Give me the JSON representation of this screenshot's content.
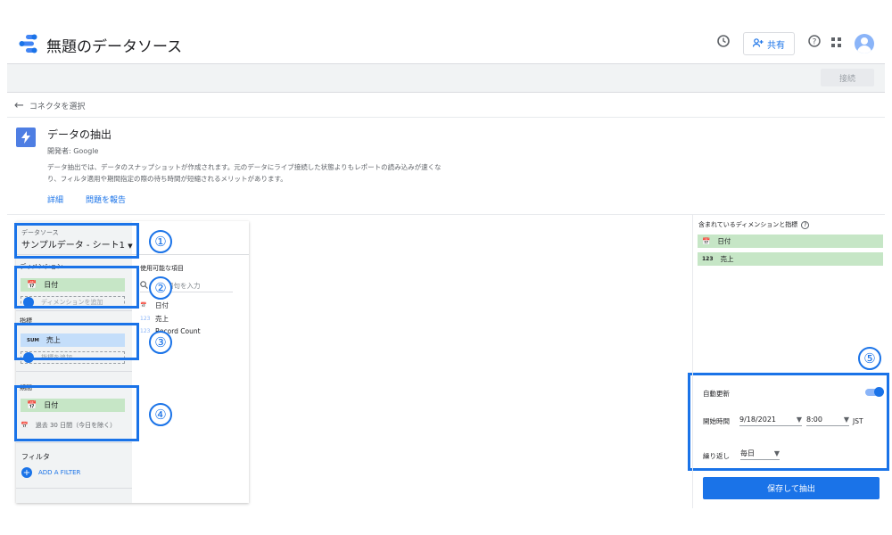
{
  "header": {
    "title": "無題のデータソース",
    "share_label": "共有",
    "icons": [
      "history-icon",
      "add-person-icon",
      "help-icon",
      "apps-grid-icon",
      "account-icon"
    ]
  },
  "toolbar": {
    "connect_label": "接続"
  },
  "back": {
    "label": "コネクタを選択"
  },
  "connector": {
    "title": "データの抽出",
    "developer": "開発者: Google",
    "description_line1": "データ抽出では、データのスナップショットが作成されます。元のデータにライブ接続した状態よりもレポートの読み込みが速くな",
    "description_line2": "り、フィルタ適用や期間指定の際の待ち時間が短縮されるメリットがあります。",
    "link_details": "詳細",
    "link_report": "問題を報告"
  },
  "config": {
    "datasource_label": "データソース",
    "datasource_value": "サンプルデータ - シート1",
    "dimension_label": "ディメンション",
    "dimension_chip": "日付",
    "dimension_add": "ディメンションを追加",
    "metric_label": "指標",
    "metric_chip": "売上",
    "metric_add": "指標を追加",
    "period_label": "期間",
    "period_chip": "日付",
    "period_range": "過去 30 日間（今日を除く）",
    "filter_label": "フィルタ",
    "add_filter": "ADD A FILTER"
  },
  "available": {
    "title": "使用可能な項目",
    "search_placeholder": "検索語句を入力",
    "fields": [
      {
        "type": "date",
        "name": "日付"
      },
      {
        "type": "123",
        "name": "売上"
      },
      {
        "type": "123",
        "name": "Record Count"
      }
    ]
  },
  "included": {
    "title": "含まれているディメンションと指標",
    "items": [
      {
        "type": "date",
        "name": "日付"
      },
      {
        "type": "123",
        "name": "売上"
      }
    ]
  },
  "refresh": {
    "auto_label": "自動更新",
    "start_label": "開始時間",
    "start_date": "9/18/2021",
    "start_time": "8:00",
    "timezone": "JST",
    "repeat_label": "繰り返し",
    "repeat_value": "毎日",
    "save_label": "保存して抽出"
  },
  "annotations": [
    "①",
    "②",
    "③",
    "④",
    "⑤"
  ],
  "colors": {
    "accent": "#1a73e8",
    "dimension_chip": "#c6e6c6",
    "metric_chip": "#c4defa"
  }
}
